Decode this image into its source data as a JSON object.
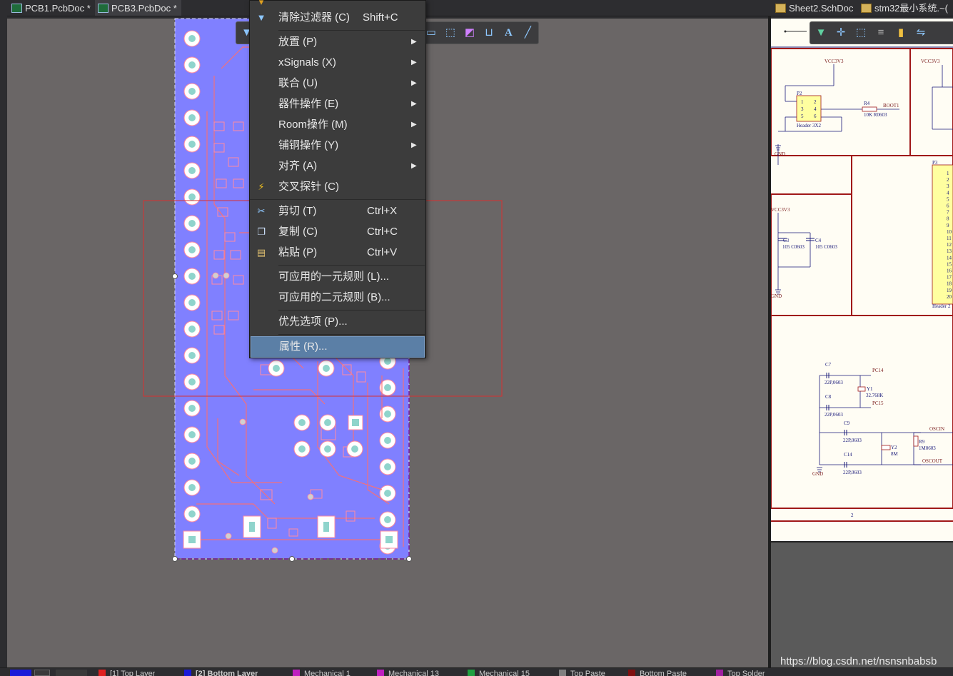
{
  "tabs": [
    {
      "label": "PCB1.PcbDoc *",
      "active": false
    },
    {
      "label": "PCB3.PcbDoc *",
      "active": true
    },
    {
      "label": "Sheet2.SchDoc",
      "active": false
    },
    {
      "label": "stm32最小系统.~(",
      "active": false
    }
  ],
  "menu": {
    "items": [
      {
        "label": "清除过滤器 (C)",
        "shortcut": "Shift+C",
        "icon": "clear-filter-icon"
      },
      {
        "label": "放置 (P)",
        "submenu": true
      },
      {
        "label": "xSignals (X)",
        "submenu": true
      },
      {
        "label": "联合 (U)",
        "submenu": true
      },
      {
        "label": "器件操作 (E)",
        "submenu": true
      },
      {
        "label": "Room操作 (M)",
        "submenu": true
      },
      {
        "label": "铺铜操作 (Y)",
        "submenu": true
      },
      {
        "label": "对齐 (A)",
        "submenu": true
      },
      {
        "label": "交叉探针 (C)",
        "icon": "cross-probe-icon"
      },
      {
        "label": "剪切 (T)",
        "shortcut": "Ctrl+X",
        "icon": "cut-icon"
      },
      {
        "label": "复制 (C)",
        "shortcut": "Ctrl+C",
        "icon": "copy-icon"
      },
      {
        "label": "粘贴 (P)",
        "shortcut": "Ctrl+V",
        "icon": "paste-icon"
      },
      {
        "label": "可应用的一元规则 (L)..."
      },
      {
        "label": "可应用的二元规则 (B)..."
      },
      {
        "label": "优先选项 (P)..."
      },
      {
        "label": "属性 (R)...",
        "selected": true
      }
    ]
  },
  "schematic": {
    "labels": {
      "vcc1": "VCC3V3",
      "vcc2": "VCC3V3",
      "vcc3": "VCC3V3",
      "p2": "P2",
      "hdr3x2": "Header 3X2",
      "r4": "R4",
      "r4v": "10K R0603",
      "boot1": "BOOT1",
      "gnd1": "GND",
      "gnd2": "GND",
      "gnd3": "GND",
      "p3": "P3",
      "hdr20": "Header 2",
      "c3": "C3",
      "c3v": "105 C0603",
      "c4": "C4",
      "c4v": "105 C0603",
      "c7": "C7",
      "c7v": "22P,0603",
      "pc14": "PC14",
      "y1": "Y1",
      "y1v": "32.768K",
      "c8": "C8",
      "c8v": "22P,0603",
      "pc15": "PC15",
      "c9": "C9",
      "c9v": "22P,0603",
      "oscin": "OSCIN",
      "y2": "Y2",
      "y2v": "8M",
      "r9": "R9",
      "r9v": "1M0603",
      "c14": "C14",
      "c14v": "22P,0603",
      "oscout": "OSCOUT",
      "sheetnum": "2"
    },
    "header_pins": [
      "1",
      "2",
      "3",
      "4",
      "5",
      "6",
      "7",
      "8",
      "9",
      "10",
      "11",
      "12",
      "13",
      "14",
      "15",
      "16",
      "17",
      "18",
      "19",
      "20"
    ],
    "p2_pins": [
      "1",
      "2",
      "3",
      "4",
      "5",
      "6"
    ]
  },
  "status_layers": [
    {
      "label": "[1] Top Layer",
      "color": "#e02020"
    },
    {
      "label": "[2] Bottom Layer",
      "color": "#1a1ad8"
    },
    {
      "label": "Mechanical 1",
      "color": "#c020c0"
    },
    {
      "label": "Mechanical 13",
      "color": "#c020c0"
    },
    {
      "label": "Mechanical 15",
      "color": "#20a040"
    },
    {
      "label": "Top Paste",
      "color": "#808080"
    },
    {
      "label": "Bottom Paste",
      "color": "#801010"
    },
    {
      "label": "Top Solder",
      "color": "#a020a0"
    }
  ],
  "watermark": "https://blog.csdn.net/nsnsnbabsb"
}
